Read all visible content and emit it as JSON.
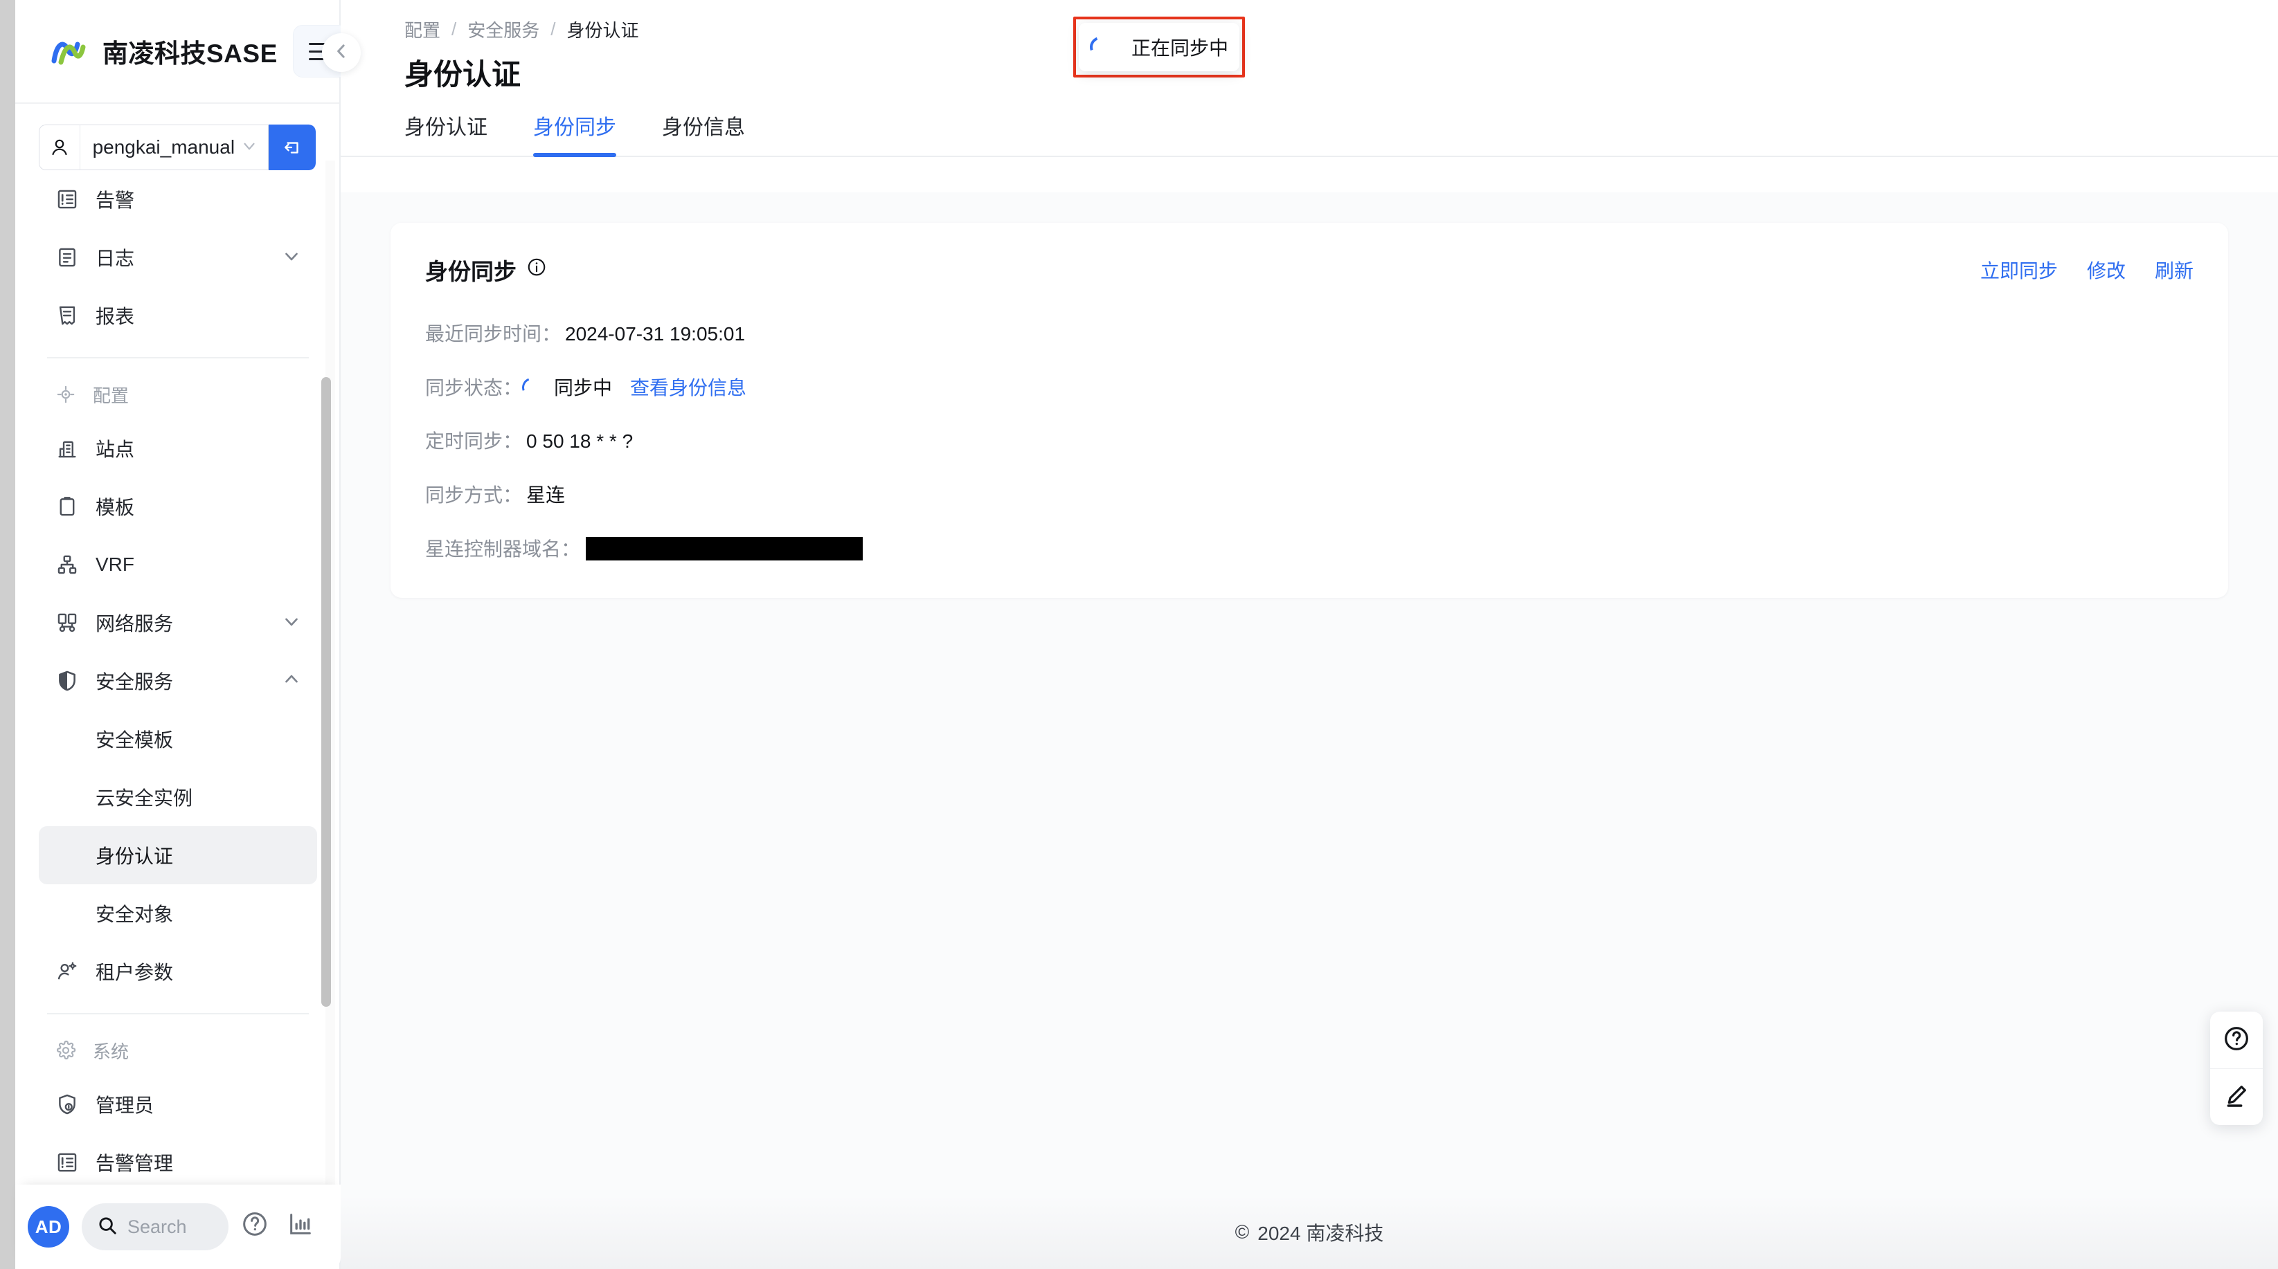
{
  "brand": {
    "name": "南凌科技SASE",
    "logo_icon": "nanling-logo-icon",
    "hamburger_icon": "hamburger-icon"
  },
  "user_switcher": {
    "avatar_icon": "user-icon",
    "name": "pengkai_manual",
    "caret_icon": "chevron-down-icon",
    "logout_icon": "logout-icon"
  },
  "sidebar": {
    "items": [
      {
        "label": "告警",
        "icon": "alert-list-icon",
        "type": "item",
        "caret": "",
        "active": false
      },
      {
        "label": "日志",
        "icon": "log-icon",
        "type": "item",
        "caret": "down",
        "active": false
      },
      {
        "label": "报表",
        "icon": "report-icon",
        "type": "item",
        "caret": "",
        "active": false
      },
      {
        "label": "配置",
        "icon": "config-target-icon",
        "type": "group",
        "caret": "",
        "active": false
      },
      {
        "label": "站点",
        "icon": "site-building-icon",
        "type": "item",
        "caret": "",
        "active": false
      },
      {
        "label": "模板",
        "icon": "template-icon",
        "type": "item",
        "caret": "",
        "active": false
      },
      {
        "label": "VRF",
        "icon": "vrf-network-icon",
        "type": "item",
        "caret": "",
        "active": false
      },
      {
        "label": "网络服务",
        "icon": "network-service-icon",
        "type": "item",
        "caret": "down",
        "active": false
      },
      {
        "label": "安全服务",
        "icon": "shield-icon",
        "type": "item",
        "caret": "up",
        "active": false
      },
      {
        "label": "安全模板",
        "icon": "",
        "type": "sub",
        "caret": "",
        "active": false
      },
      {
        "label": "云安全实例",
        "icon": "",
        "type": "sub",
        "caret": "",
        "active": false
      },
      {
        "label": "身份认证",
        "icon": "",
        "type": "sub",
        "caret": "",
        "active": true
      },
      {
        "label": "安全对象",
        "icon": "",
        "type": "sub",
        "caret": "",
        "active": false
      },
      {
        "label": "租户参数",
        "icon": "tenant-param-icon",
        "type": "item",
        "caret": "",
        "active": false
      },
      {
        "label": "系统",
        "icon": "gear-icon",
        "type": "group",
        "caret": "",
        "active": false
      },
      {
        "label": "管理员",
        "icon": "admin-shield-icon",
        "type": "item",
        "caret": "",
        "active": false
      },
      {
        "label": "告警管理",
        "icon": "alert-list-icon",
        "type": "item",
        "caret": "",
        "active": false
      }
    ],
    "bottom": {
      "avatar_initials": "AD",
      "search_placeholder": "Search",
      "search_icon": "search-icon",
      "help_icon": "help-circle-icon",
      "stats_icon": "bar-chart-icon"
    },
    "collapse_icon": "chevron-left-icon"
  },
  "breadcrumb": {
    "items": [
      "配置",
      "安全服务",
      "身份认证"
    ],
    "separator": "/"
  },
  "page": {
    "title": "身份认证"
  },
  "tabs": [
    {
      "label": "身份认证",
      "active": false
    },
    {
      "label": "身份同步",
      "active": true
    },
    {
      "label": "身份信息",
      "active": false
    }
  ],
  "toast": {
    "text": "正在同步中",
    "spinner_icon": "loading-spinner-icon",
    "highlight_color": "#e8341c"
  },
  "card": {
    "title": "身份同步",
    "info_icon": "info-circle-icon",
    "actions": [
      {
        "label": "立即同步"
      },
      {
        "label": "修改"
      },
      {
        "label": "刷新"
      }
    ],
    "fields": [
      {
        "label": "最近同步时间：",
        "value": "2024-07-31 19:05:01",
        "link": "",
        "spinner": false,
        "redacted": false
      },
      {
        "label": "同步状态：",
        "value": "同步中",
        "link": "查看身份信息",
        "spinner": true,
        "redacted": false
      },
      {
        "label": "定时同步：",
        "value": "0 50 18 * * ?",
        "link": "",
        "spinner": false,
        "redacted": false
      },
      {
        "label": "同步方式：",
        "value": "星连",
        "link": "",
        "spinner": false,
        "redacted": false
      },
      {
        "label": "星连控制器域名：",
        "value": "",
        "link": "",
        "spinner": false,
        "redacted": true
      }
    ]
  },
  "footer": {
    "copyright_symbol": "©",
    "text": "2024 南凌科技"
  },
  "dock": [
    {
      "icon": "help-circle-icon",
      "name": "help-button"
    },
    {
      "icon": "edit-pencil-icon",
      "name": "feedback-button"
    }
  ],
  "colors": {
    "accent": "#2f6ef0",
    "highlight": "#e8341c",
    "text": "#14161a",
    "muted": "#8b9099"
  }
}
